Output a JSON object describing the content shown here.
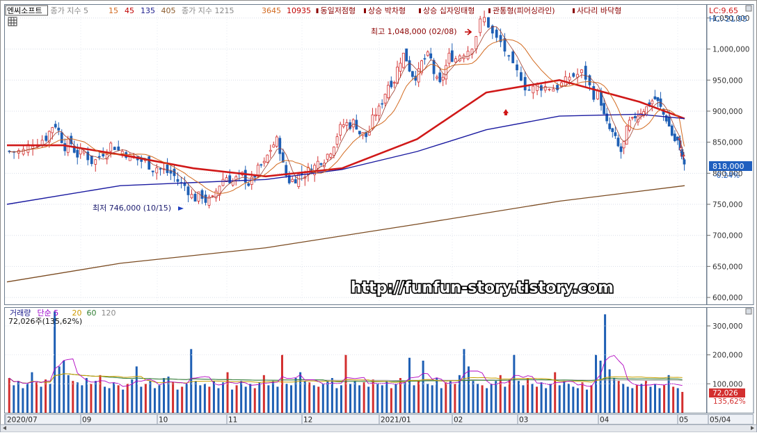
{
  "price_panel": {
    "legend": [
      {
        "text": "엔씨소프트",
        "color": "#000000",
        "boxed": true
      },
      {
        "text": "종가 지수 5",
        "color": "#888888"
      },
      {
        "text": "15",
        "color": "#d2691e"
      },
      {
        "text": "45",
        "color": "#c00000"
      },
      {
        "text": "135",
        "color": "#1a1a8c"
      },
      {
        "text": "405",
        "color": "#8b5a2b"
      },
      {
        "text": "종가 지수 1215",
        "color": "#888888"
      },
      {
        "text": "3645",
        "color": "#d2691e"
      },
      {
        "text": "10935",
        "color": "#c00000"
      },
      {
        "text": "동일저점형",
        "color": "#8b0000"
      },
      {
        "text": "상승 박차형",
        "color": "#8b0000"
      },
      {
        "text": "상승 십자잉태형",
        "color": "#8b0000"
      },
      {
        "text": "관통형(피어싱라인)",
        "color": "#8b0000"
      },
      {
        "text": "사다리 바닥형",
        "color": "#8b0000"
      }
    ],
    "lc_label": "LC:9.65",
    "hc_label": "HC:-21.95",
    "high_annotation": "최고 1,048,000 (02/08)",
    "low_annotation": "최저 746,000 (10/15)",
    "current_price_tag": "818,000",
    "current_change_tag": "-0.24%",
    "y_ticks": [
      "1,050,000",
      "1,000,000",
      "950,000",
      "900,000",
      "850,000",
      "800,000",
      "750,000",
      "700,000",
      "650,000",
      "600,000"
    ],
    "watermark": "http://funfun-story.tistory.com"
  },
  "volume_panel": {
    "legend": [
      {
        "text": "거래량",
        "color": "#1a1a8c"
      },
      {
        "text": "단순 5",
        "color": "#9900cc"
      },
      {
        "text": "20",
        "color": "#cc9900"
      },
      {
        "text": "60",
        "color": "#2e7d32"
      },
      {
        "text": "120",
        "color": "#888888"
      }
    ],
    "volume_label": "72,026주(135,62%)",
    "y_ticks": [
      "300,000",
      "200,000",
      "100,000"
    ],
    "current_volume_tag": "72,026",
    "current_ratio_tag": "135,62%"
  },
  "date_axis": [
    "2020/07",
    "09",
    "10",
    "11",
    "12",
    "2021/01",
    "02",
    "03",
    "04",
    "05",
    "05/04"
  ],
  "colors": {
    "up": "#d32f2f",
    "down": "#1e5fb4",
    "ma5": "#8a8a8a",
    "ma15": "#d2691e",
    "ma45": "#d01818",
    "ma135": "#1a1aa0",
    "ma405": "#7a4a20",
    "vol_ma5": "#b000c0",
    "vol_ma20": "#c8a000",
    "vol_ma60": "#2e7d32",
    "vol_ma120": "#999999",
    "tag_bg": "#1f5fbf",
    "vol_tag_bg": "#d32f2f"
  },
  "chart_data": [
    {
      "type": "candlestick",
      "title": "엔씨소프트",
      "x_range": [
        "2020/07",
        "2021/05/04"
      ],
      "ylim": [
        590000,
        1070000
      ],
      "high_point": {
        "date": "02/08",
        "value": 1048000
      },
      "low_point": {
        "date": "10/15",
        "value": 746000
      },
      "last_close": 818000,
      "last_change_pct": -0.24,
      "series": [
        {
          "name": "종가",
          "points": [
            [
              "2020/07",
              835000
            ],
            [
              "2020/07",
              855000
            ],
            [
              "2020/08",
              880000
            ],
            [
              "2020/08",
              845000
            ],
            [
              "2020/08",
              830000
            ],
            [
              "2020/09",
              820000
            ],
            [
              "2020/09",
              845000
            ],
            [
              "2020/09",
              835000
            ],
            [
              "2020/09",
              820000
            ],
            [
              "2020/09",
              810000
            ],
            [
              "2020/10",
              800000
            ],
            [
              "2020/10",
              780000
            ],
            [
              "2020/10",
              760000
            ],
            [
              "2020/10",
              755000
            ],
            [
              "2020/10",
              795000
            ],
            [
              "2020/11",
              790000
            ],
            [
              "2020/11",
              785000
            ],
            [
              "2020/11",
              812000
            ],
            [
              "2020/11",
              850000
            ],
            [
              "2020/11",
              790000
            ],
            [
              "2020/11",
              800000
            ],
            [
              "2020/12",
              810000
            ],
            [
              "2020/12",
              830000
            ],
            [
              "2020/12",
              870000
            ],
            [
              "2020/12",
              880000
            ],
            [
              "2020/12",
              860000
            ],
            [
              "2020/12",
              900000
            ],
            [
              "2021/01",
              950000
            ],
            [
              "2021/01",
              990000
            ],
            [
              "2021/01",
              960000
            ],
            [
              "2021/01",
              985000
            ],
            [
              "2021/01",
              940000
            ],
            [
              "2021/01",
              990000
            ],
            [
              "2021/02",
              1000000
            ],
            [
              "2021/02",
              1048000
            ],
            [
              "2021/02",
              1010000
            ],
            [
              "2021/02",
              960000
            ],
            [
              "2021/03",
              935000
            ],
            [
              "2021/03",
              940000
            ],
            [
              "2021/03",
              945000
            ],
            [
              "2021/03",
              960000
            ],
            [
              "2021/03",
              925000
            ],
            [
              "2021/04",
              870000
            ],
            [
              "2021/04",
              835000
            ],
            [
              "2021/04",
              880000
            ],
            [
              "2021/04",
              905000
            ],
            [
              "2021/04",
              920000
            ],
            [
              "2021/04",
              890000
            ],
            [
              "2021/04",
              850000
            ],
            [
              "2021/05",
              835000
            ],
            [
              "2021/05",
              818000
            ]
          ]
        },
        {
          "name": "이동평균 45",
          "points": [
            [
              "2020/07",
              845000
            ],
            [
              "2020/08",
              845000
            ],
            [
              "2020/09",
              830000
            ],
            [
              "2020/10",
              808000
            ],
            [
              "2020/11",
              795000
            ],
            [
              "2020/12",
              808000
            ],
            [
              "2021/01",
              855000
            ],
            [
              "2021/02",
              930000
            ],
            [
              "2021/03",
              950000
            ],
            [
              "2021/04",
              915000
            ],
            [
              "2021/05",
              888000
            ]
          ]
        },
        {
          "name": "이동평균 135",
          "points": [
            [
              "2020/07",
              750000
            ],
            [
              "2020/09",
              780000
            ],
            [
              "2020/11",
              790000
            ],
            [
              "2020/12",
              806000
            ],
            [
              "2021/01",
              835000
            ],
            [
              "2021/02",
              870000
            ],
            [
              "2021/03",
              892000
            ],
            [
              "2021/04",
              895000
            ],
            [
              "2021/05",
              888000
            ]
          ]
        },
        {
          "name": "이동평균 405",
          "points": [
            [
              "2020/07",
              625000
            ],
            [
              "2020/09",
              655000
            ],
            [
              "2020/11",
              680000
            ],
            [
              "2021/01",
              718000
            ],
            [
              "2021/03",
              755000
            ],
            [
              "2021/05",
              780000
            ]
          ]
        }
      ]
    },
    {
      "type": "bar",
      "title": "거래량",
      "ylim": [
        0,
        360000
      ],
      "last_volume": 72026,
      "last_ratio_pct": 135.62,
      "values": [
        120000,
        95000,
        110000,
        85000,
        100000,
        140000,
        105000,
        90000,
        115000,
        100000,
        350000,
        160000,
        180000,
        130000,
        110000,
        105000,
        95000,
        120000,
        100000,
        110000,
        130000,
        90000,
        85000,
        105000,
        95000,
        80000,
        100000,
        115000,
        160000,
        90000,
        100000,
        110000,
        85000,
        95000,
        120000,
        125000,
        105000,
        80000,
        90000,
        100000,
        220000,
        110000,
        95000,
        100000,
        90000,
        110000,
        85000,
        105000,
        140000,
        80000,
        95000,
        110000,
        90000,
        100000,
        85000,
        105000,
        130000,
        95000,
        110000,
        90000,
        200000,
        100000,
        95000,
        120000,
        140000,
        110000,
        105000,
        95000,
        90000,
        100000,
        110000,
        120000,
        85000,
        95000,
        200000,
        100000,
        110000,
        95000,
        105000,
        90000,
        115000,
        100000,
        95000,
        110000,
        85000,
        100000,
        120000,
        105000,
        190000,
        95000,
        110000,
        180000,
        100000,
        95000,
        120000,
        85000,
        105000,
        110000,
        100000,
        130000,
        220000,
        160000,
        110000,
        100000,
        95000,
        85000,
        100000,
        110000,
        130000,
        90000,
        115000,
        200000,
        110000,
        95000,
        120000,
        100000,
        90000,
        105000,
        85000,
        100000,
        140000,
        95000,
        110000,
        100000,
        90000,
        85000,
        105000,
        80000,
        95000,
        200000,
        180000,
        340000,
        150000,
        120000,
        110000,
        100000,
        90000,
        85000,
        95000,
        100000,
        110000,
        90000,
        100000,
        85000,
        95000,
        130000,
        90000,
        85000,
        72026
      ]
    }
  ]
}
